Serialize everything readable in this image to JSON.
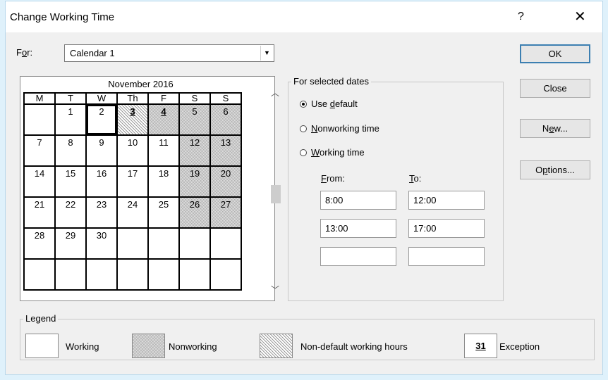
{
  "title": "Change Working Time",
  "help_glyph": "?",
  "close_glyph": "✕",
  "for": {
    "label_prefix": "F",
    "label_underlined": "o",
    "label_suffix": "r:",
    "value": "Calendar 1"
  },
  "calendar": {
    "month": "November 2016",
    "weekdays": [
      "M",
      "T",
      "W",
      "Th",
      "F",
      "S",
      "S"
    ],
    "selected_day": "2",
    "exception_days": [
      "3",
      "4"
    ],
    "weekend_days": [
      "5",
      "6",
      "12",
      "13",
      "19",
      "20",
      "26",
      "27"
    ]
  },
  "selected_dates": {
    "title": "For selected dates",
    "options": [
      {
        "pre": "Use ",
        "u": "d",
        "post": "efault",
        "checked": true
      },
      {
        "pre": "",
        "u": "N",
        "post": "onworking time",
        "checked": false
      },
      {
        "pre": "",
        "u": "W",
        "post": "orking time",
        "checked": false
      }
    ],
    "from_label": "From:",
    "to_label": "To:",
    "from_values": [
      "8:00",
      "13:00",
      ""
    ],
    "to_values": [
      "12:00",
      "17:00",
      ""
    ]
  },
  "buttons": {
    "ok": "OK",
    "close": "Close",
    "new_pre": "N",
    "new_u": "e",
    "new_post": "w...",
    "options_pre": "O",
    "options_u": "p",
    "options_post": "tions..."
  },
  "legend": {
    "title": "Legend",
    "working": "Working",
    "nonworking": "Nonworking",
    "nondefault": "Non-default working hours",
    "exception_number": "31",
    "exception": "Exception"
  }
}
